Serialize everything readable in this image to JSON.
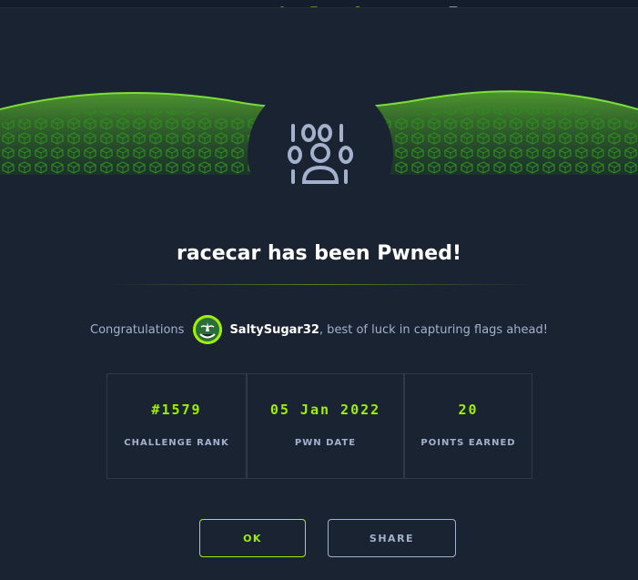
{
  "header_icon": "binary-user-icon",
  "title": "racecar has been Pwned!",
  "congrats": {
    "prefix": "Congratulations",
    "avatar_icon": "user-avatar-icon",
    "username": "SaltySugar32",
    "suffix": ", best of luck in capturing flags ahead!"
  },
  "stats": [
    {
      "value": "#1579",
      "label": "CHALLENGE RANK"
    },
    {
      "value": "05 Jan 2022",
      "label": "PWN DATE"
    },
    {
      "value": "20",
      "label": "POINTS EARNED"
    }
  ],
  "buttons": {
    "ok": "OK",
    "share": "SHARE"
  },
  "colors": {
    "accent": "#9fef00",
    "background": "#1a2332",
    "muted_text": "#a4b1cd"
  }
}
